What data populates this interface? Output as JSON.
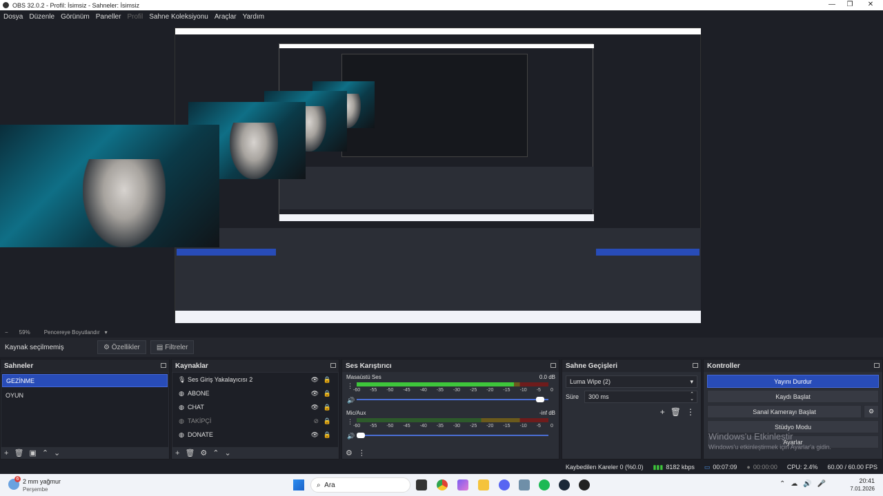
{
  "window": {
    "title": "OBS 32.0.2 - Profil: İsimsiz - Sahneler: İsimsiz",
    "minimize": "—",
    "restore": "❐",
    "close": "✕"
  },
  "menu": [
    "Dosya",
    "Düzenle",
    "Görünüm",
    "Paneller",
    "Profil",
    "Sahne Koleksiyonu",
    "Araçlar",
    "Yardım"
  ],
  "preview": {
    "zoom": "59%",
    "zoom_minus": "−",
    "fit_label": "Pencereye Boyutlandır"
  },
  "source_bar": {
    "status": "Kaynak seçilmemiş",
    "properties": "Özellikler",
    "filters": "Filtreler"
  },
  "docks": {
    "scenes": {
      "title": "Sahneler",
      "items": [
        "GEZİNME",
        "OYUN"
      ],
      "selected": 0
    },
    "sources": {
      "title": "Kaynaklar",
      "items": [
        {
          "name": "Ses Giriş Yakalayıcısı 2",
          "icon": "microphone-icon",
          "glyph": "🎙",
          "visible": true
        },
        {
          "name": "ABONE",
          "icon": "browser-icon",
          "glyph": "◍",
          "visible": true
        },
        {
          "name": "CHAT",
          "icon": "browser-icon",
          "glyph": "◍",
          "visible": true
        },
        {
          "name": "TAKİPÇİ",
          "icon": "browser-icon",
          "glyph": "◍",
          "visible": false
        },
        {
          "name": "DONATE",
          "icon": "browser-icon",
          "glyph": "◍",
          "visible": true
        }
      ]
    },
    "mixer": {
      "title": "Ses Karıştırıcı",
      "channels": [
        {
          "name": "Masaüstü Ses",
          "db": "0.0 dB",
          "level": 0.82,
          "volume": 0.98
        },
        {
          "name": "Mic/Aux",
          "db": "-inf dB",
          "level": 0.0,
          "volume": 0.02
        }
      ],
      "ticks": [
        "-60",
        "-55",
        "-50",
        "-45",
        "-40",
        "-35",
        "-30",
        "-25",
        "-20",
        "-15",
        "-10",
        "-5",
        "0"
      ]
    },
    "transitions": {
      "title": "Sahne Geçişleri",
      "selected": "Luma Wipe (2)",
      "duration_label": "Süre",
      "duration": "300 ms"
    },
    "controls": {
      "title": "Kontroller",
      "buttons": [
        "Yayını Durdur",
        "Kaydı Başlat",
        "Sanal Kamerayı Başlat",
        "Stüdyo Modu",
        "Ayarlar"
      ]
    }
  },
  "watermark": {
    "title": "Windows'u Etkinleştir",
    "subtitle": "Windows'u etkinleştirmek için Ayarlar'a gidin."
  },
  "status": {
    "dropped": "Kaybedilen Kareler 0 (%0.0)",
    "bitrate": "8182 kbps",
    "stream_time": "00:07:09",
    "rec_time": "00:00:00",
    "cpu": "CPU: 2.4%",
    "fps": "60.00 / 60.00 FPS"
  },
  "taskbar": {
    "weather_badge": "6",
    "weather": "2 mm yağmur",
    "weather_sub": "Perşembe",
    "search": "Ara",
    "time": "20:41",
    "date": "7.01.2026"
  },
  "colors": {
    "accent": "#284cb8",
    "bg": "#1d1f26",
    "panel": "#2b2e36"
  }
}
